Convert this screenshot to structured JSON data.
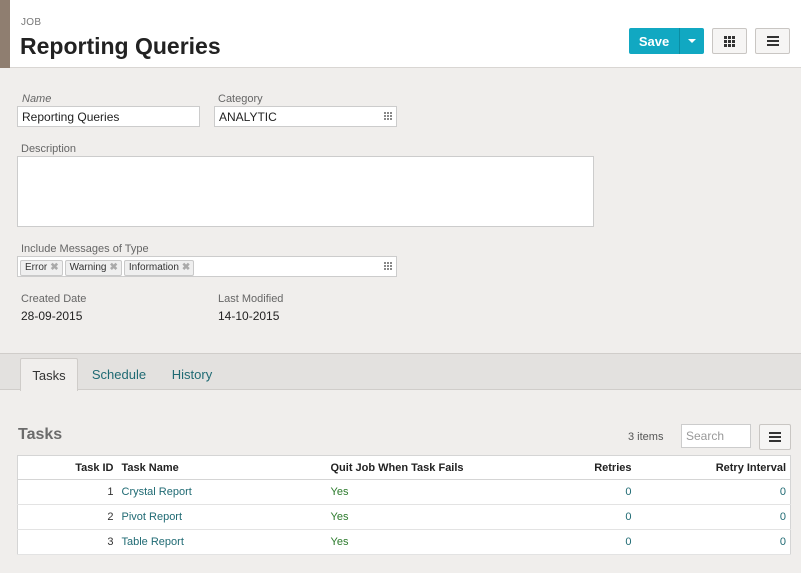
{
  "header": {
    "kicker": "JOB",
    "title": "Reporting Queries",
    "save_label": "Save",
    "accent_color": "#8f7e70",
    "save_color": "#11a8c2"
  },
  "form": {
    "name_label": "Name",
    "name_value": "Reporting Queries",
    "category_label": "Category",
    "category_value": "ANALYTIC",
    "description_label": "Description",
    "description_value": "",
    "messages_label": "Include Messages of Type",
    "message_tags": [
      "Error",
      "Warning",
      "Information"
    ],
    "created_label": "Created Date",
    "created_value": "28-09-2015",
    "modified_label": "Last Modified",
    "modified_value": "14-10-2015"
  },
  "tabs": [
    {
      "label": "Tasks",
      "active": true
    },
    {
      "label": "Schedule",
      "active": false
    },
    {
      "label": "History",
      "active": false
    }
  ],
  "tasks": {
    "title": "Tasks",
    "count": "3 items",
    "search_placeholder": "Search",
    "columns": [
      "Task ID",
      "Task Name",
      "Quit Job When Task Fails",
      "Retries",
      "Retry Interval"
    ],
    "rows": [
      {
        "id": "1",
        "name": "Crystal Report",
        "quit": "Yes",
        "retries": "0",
        "interval": "0"
      },
      {
        "id": "2",
        "name": "Pivot Report",
        "quit": "Yes",
        "retries": "0",
        "interval": "0"
      },
      {
        "id": "3",
        "name": "Table Report",
        "quit": "Yes",
        "retries": "0",
        "interval": "0"
      }
    ]
  },
  "icons": [
    "grid-view-icon",
    "menu-icon",
    "dropdown-caret-icon",
    "selector-dots-icon",
    "remove-tag-icon",
    "list-menu-icon"
  ]
}
